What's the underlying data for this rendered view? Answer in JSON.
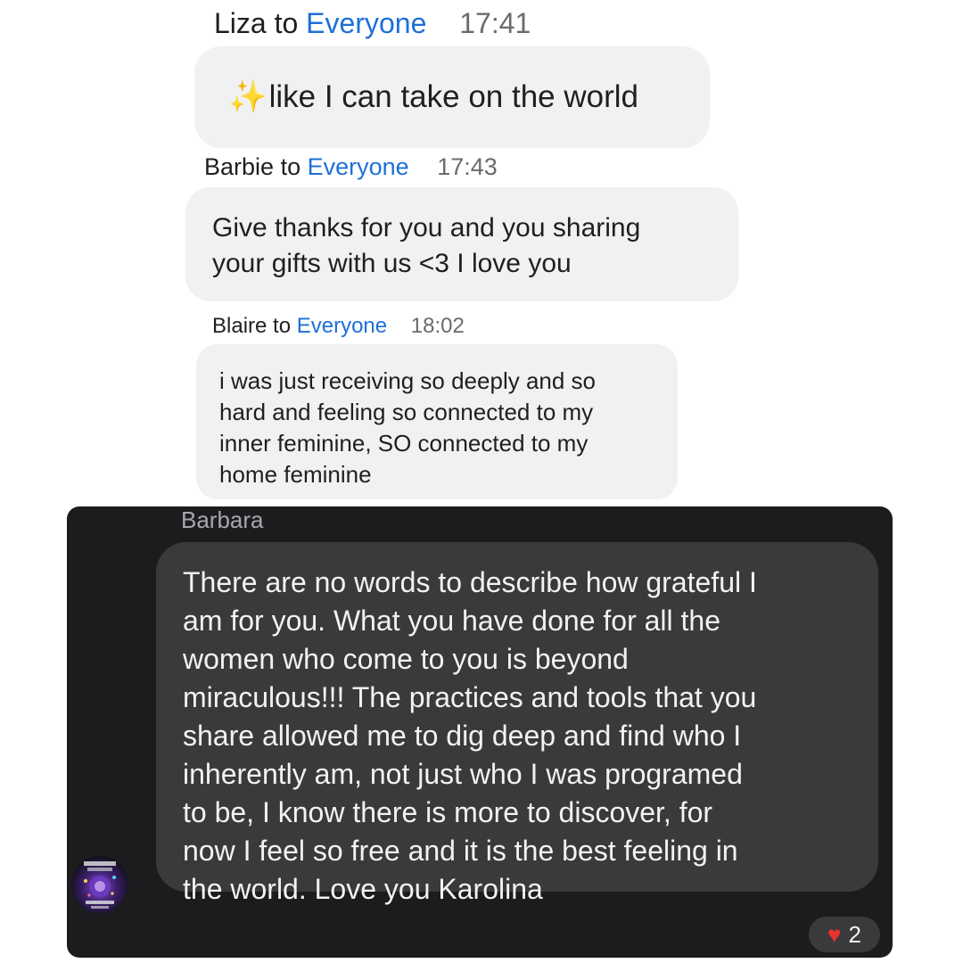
{
  "messages": [
    {
      "sender": "Liza",
      "to_word": "to",
      "recipient": "Everyone",
      "time": "17:41",
      "icon": "sparkles-icon",
      "text": "like I can take on the world"
    },
    {
      "sender": "Barbie",
      "to_word": "to",
      "recipient": "Everyone",
      "time": "17:43",
      "text": "Give thanks for you  and you sharing\nyour gifts with us <3 I love you"
    },
    {
      "sender": "Blaire",
      "to_word": "to",
      "recipient": "Everyone",
      "time": "18:02",
      "text": "i was just receiving so deeply and so\nhard and feeling so connected to my\ninner feminine, SO connected to my\nhome feminine"
    }
  ],
  "dark_message": {
    "sender": "Barbara",
    "text": "There are  no words to describe how grateful I\nam for you. What you have done for all the\nwomen who come to you is beyond\nmiraculous!!!  The practices and tools that you\nshare allowed me to dig deep and find who I\ninherently am, not just who I was programed\nto be, I know there is more to discover, for\nnow I feel so free and it is the best feeling in\nthe world. Love you Karolina",
    "reaction_icon": "heart-icon",
    "reaction_count": "2"
  },
  "colors": {
    "recipient_blue": "#1e6fd9",
    "light_bubble": "#f1f1f4",
    "dark_panel": "#1c1c1e",
    "dark_bubble": "#3a3a3c",
    "heart_red": "#e8332e"
  }
}
